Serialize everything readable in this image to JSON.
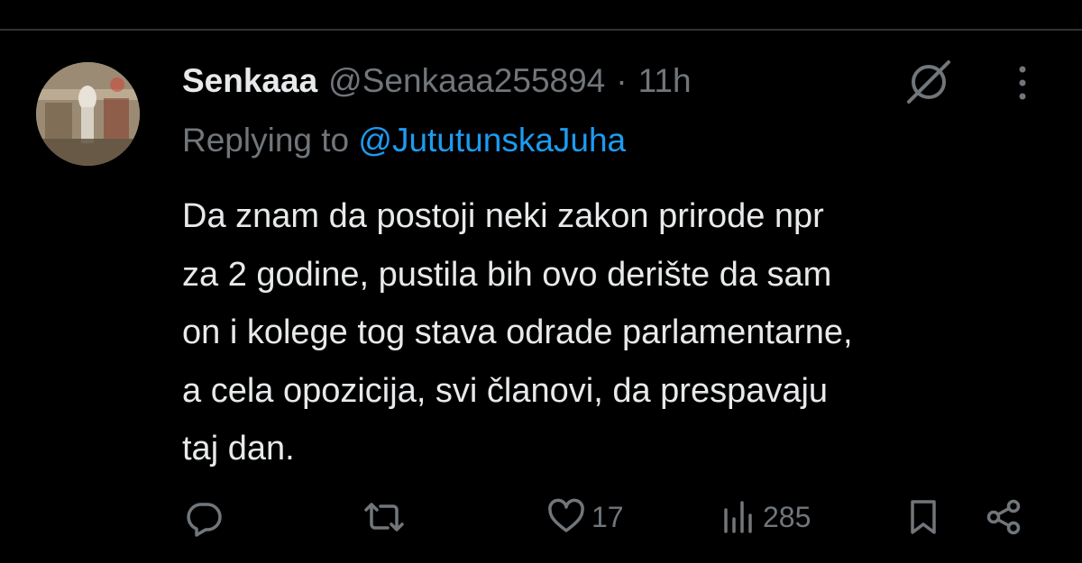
{
  "tweet": {
    "author_name": "Senkaaa",
    "author_handle": "@Senkaaa255894",
    "separator": "·",
    "time": "11h",
    "reply_prefix": "Replying to",
    "reply_to": "@JututunskaJuha",
    "text_lines": [
      "Da znam da postoji neki zakon prirode npr",
      "za 2 godine, pustila bih ovo derište da sam",
      "on i kolege tog stava odrade parlamentarne,",
      "a cela opozicija, svi članovi, da prespavaju",
      "taj dan."
    ]
  },
  "actions": {
    "reply_icon": "reply-icon",
    "retweet_icon": "retweet-icon",
    "like_icon": "heart-icon",
    "like_count": "17",
    "views_icon": "views-icon",
    "views_count": "285",
    "bookmark_icon": "bookmark-icon",
    "share_icon": "share-icon"
  },
  "header_icons": [
    "grok-icon",
    "more-icon"
  ],
  "colors": {
    "background": "#000000",
    "text": "#e7e9ea",
    "muted": "#71767b",
    "link": "#1d9bf0",
    "divider": "#2f3336"
  }
}
